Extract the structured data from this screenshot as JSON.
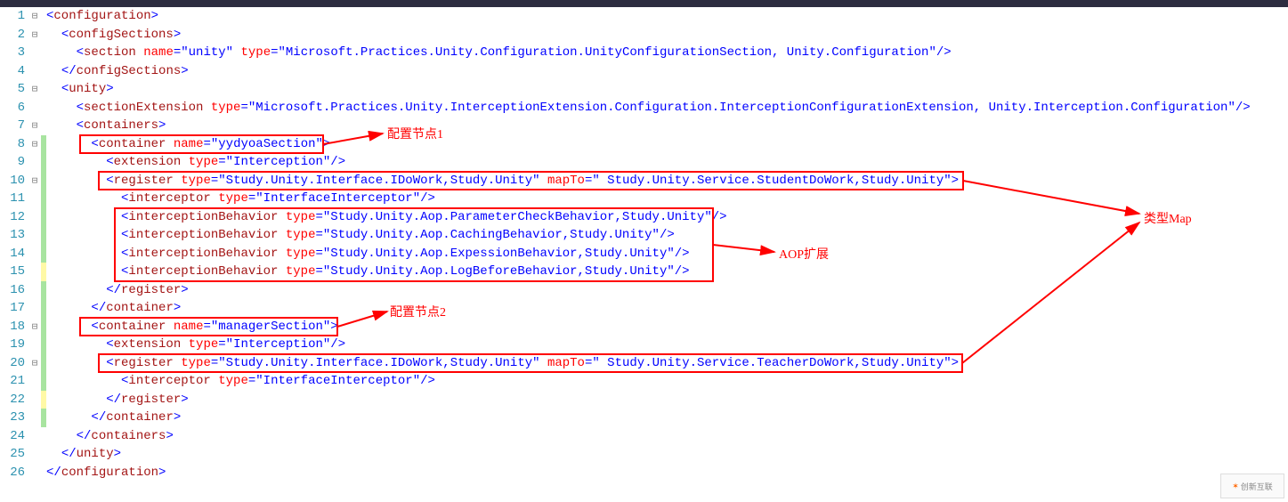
{
  "lines": [
    {
      "n": 1,
      "fold": "⊟",
      "mark": "",
      "indent": 0,
      "tokens": [
        {
          "c": "t-blue",
          "t": "<"
        },
        {
          "c": "t-maroon",
          "t": "configuration"
        },
        {
          "c": "t-blue",
          "t": ">"
        }
      ]
    },
    {
      "n": 2,
      "fold": "⊟",
      "mark": "",
      "indent": 1,
      "tokens": [
        {
          "c": "t-blue",
          "t": "<"
        },
        {
          "c": "t-maroon",
          "t": "configSections"
        },
        {
          "c": "t-blue",
          "t": ">"
        }
      ]
    },
    {
      "n": 3,
      "fold": "",
      "mark": "",
      "indent": 2,
      "tokens": [
        {
          "c": "t-blue",
          "t": "<"
        },
        {
          "c": "t-maroon",
          "t": "section"
        },
        {
          "c": "t-black",
          "t": " "
        },
        {
          "c": "t-red",
          "t": "name"
        },
        {
          "c": "t-blue",
          "t": "=\""
        },
        {
          "c": "t-blue",
          "t": "unity"
        },
        {
          "c": "t-blue",
          "t": "\" "
        },
        {
          "c": "t-red",
          "t": "type"
        },
        {
          "c": "t-blue",
          "t": "=\""
        },
        {
          "c": "t-blue",
          "t": "Microsoft.Practices.Unity.Configuration.UnityConfigurationSection, Unity.Configuration"
        },
        {
          "c": "t-blue",
          "t": "\"/>"
        }
      ]
    },
    {
      "n": 4,
      "fold": "",
      "mark": "",
      "indent": 1,
      "tokens": [
        {
          "c": "t-blue",
          "t": "</"
        },
        {
          "c": "t-maroon",
          "t": "configSections"
        },
        {
          "c": "t-blue",
          "t": ">"
        }
      ]
    },
    {
      "n": 5,
      "fold": "⊟",
      "mark": "",
      "indent": 1,
      "tokens": [
        {
          "c": "t-blue",
          "t": "<"
        },
        {
          "c": "t-maroon",
          "t": "unity"
        },
        {
          "c": "t-blue",
          "t": ">"
        }
      ]
    },
    {
      "n": 6,
      "fold": "",
      "mark": "",
      "indent": 2,
      "tokens": [
        {
          "c": "t-blue",
          "t": "<"
        },
        {
          "c": "t-maroon",
          "t": "sectionExtension"
        },
        {
          "c": "t-black",
          "t": " "
        },
        {
          "c": "t-red",
          "t": "type"
        },
        {
          "c": "t-blue",
          "t": "=\""
        },
        {
          "c": "t-blue",
          "t": "Microsoft.Practices.Unity.InterceptionExtension.Configuration.InterceptionConfigurationExtension, Unity.Interception.Configuration"
        },
        {
          "c": "t-blue",
          "t": "\"/>"
        }
      ]
    },
    {
      "n": 7,
      "fold": "⊟",
      "mark": "",
      "indent": 2,
      "tokens": [
        {
          "c": "t-blue",
          "t": "<"
        },
        {
          "c": "t-maroon",
          "t": "containers"
        },
        {
          "c": "t-blue",
          "t": ">"
        }
      ]
    },
    {
      "n": 8,
      "fold": "⊟",
      "mark": "green",
      "indent": 3,
      "tokens": [
        {
          "c": "t-blue",
          "t": "<"
        },
        {
          "c": "t-maroon",
          "t": "container"
        },
        {
          "c": "t-black",
          "t": " "
        },
        {
          "c": "t-red",
          "t": "name"
        },
        {
          "c": "t-blue",
          "t": "=\""
        },
        {
          "c": "t-blue",
          "t": "yydyoaSection"
        },
        {
          "c": "t-blue",
          "t": "\">"
        }
      ]
    },
    {
      "n": 9,
      "fold": "",
      "mark": "green",
      "indent": 4,
      "tokens": [
        {
          "c": "t-blue",
          "t": "<"
        },
        {
          "c": "t-maroon",
          "t": "extension"
        },
        {
          "c": "t-black",
          "t": " "
        },
        {
          "c": "t-red",
          "t": "type"
        },
        {
          "c": "t-blue",
          "t": "=\""
        },
        {
          "c": "t-blue",
          "t": "Interception"
        },
        {
          "c": "t-blue",
          "t": "\"/>"
        }
      ]
    },
    {
      "n": 10,
      "fold": "⊟",
      "mark": "green",
      "indent": 4,
      "tokens": [
        {
          "c": "t-blue",
          "t": "<"
        },
        {
          "c": "t-maroon",
          "t": "register"
        },
        {
          "c": "t-black",
          "t": " "
        },
        {
          "c": "t-red",
          "t": "type"
        },
        {
          "c": "t-blue",
          "t": "=\""
        },
        {
          "c": "t-blue",
          "t": "Study.Unity.Interface.IDoWork,Study.Unity"
        },
        {
          "c": "t-blue",
          "t": "\" "
        },
        {
          "c": "t-red",
          "t": "mapTo"
        },
        {
          "c": "t-blue",
          "t": "=\""
        },
        {
          "c": "t-blue",
          "t": " Study.Unity.Service.StudentDoWork,Study.Unity"
        },
        {
          "c": "t-blue",
          "t": "\">"
        }
      ]
    },
    {
      "n": 11,
      "fold": "",
      "mark": "green",
      "indent": 5,
      "tokens": [
        {
          "c": "t-blue",
          "t": "<"
        },
        {
          "c": "t-maroon",
          "t": "interceptor"
        },
        {
          "c": "t-black",
          "t": " "
        },
        {
          "c": "t-red",
          "t": "type"
        },
        {
          "c": "t-blue",
          "t": "=\""
        },
        {
          "c": "t-blue",
          "t": "InterfaceInterceptor"
        },
        {
          "c": "t-blue",
          "t": "\"/>"
        }
      ]
    },
    {
      "n": 12,
      "fold": "",
      "mark": "green",
      "indent": 5,
      "tokens": [
        {
          "c": "t-blue",
          "t": "<"
        },
        {
          "c": "t-maroon",
          "t": "interceptionBehavior"
        },
        {
          "c": "t-black",
          "t": " "
        },
        {
          "c": "t-red",
          "t": "type"
        },
        {
          "c": "t-blue",
          "t": "=\""
        },
        {
          "c": "t-blue",
          "t": "Study.Unity.Aop.ParameterCheckBehavior,Study.Unity"
        },
        {
          "c": "t-blue",
          "t": "\"/>"
        }
      ]
    },
    {
      "n": 13,
      "fold": "",
      "mark": "green",
      "indent": 5,
      "tokens": [
        {
          "c": "t-blue",
          "t": "<"
        },
        {
          "c": "t-maroon",
          "t": "interceptionBehavior"
        },
        {
          "c": "t-black",
          "t": " "
        },
        {
          "c": "t-red",
          "t": "type"
        },
        {
          "c": "t-blue",
          "t": "=\""
        },
        {
          "c": "t-blue",
          "t": "Study.Unity.Aop.CachingBehavior,Study.Unity"
        },
        {
          "c": "t-blue",
          "t": "\"/>"
        }
      ]
    },
    {
      "n": 14,
      "fold": "",
      "mark": "green",
      "indent": 5,
      "tokens": [
        {
          "c": "t-blue",
          "t": "<"
        },
        {
          "c": "t-maroon",
          "t": "interceptionBehavior"
        },
        {
          "c": "t-black",
          "t": " "
        },
        {
          "c": "t-red",
          "t": "type"
        },
        {
          "c": "t-blue",
          "t": "=\""
        },
        {
          "c": "t-blue",
          "t": "Study.Unity.Aop.ExpessionBehavior,Study.Unity"
        },
        {
          "c": "t-blue",
          "t": "\"/>"
        }
      ]
    },
    {
      "n": 15,
      "fold": "",
      "mark": "yellow",
      "indent": 5,
      "tokens": [
        {
          "c": "t-blue",
          "t": "<"
        },
        {
          "c": "t-maroon",
          "t": "interceptionBehavior"
        },
        {
          "c": "t-black",
          "t": " "
        },
        {
          "c": "t-red",
          "t": "type"
        },
        {
          "c": "t-blue",
          "t": "=\""
        },
        {
          "c": "t-blue",
          "t": "Study.Unity.Aop.LogBeforeBehavior,Study.Unity"
        },
        {
          "c": "t-blue",
          "t": "\"/>"
        }
      ]
    },
    {
      "n": 16,
      "fold": "",
      "mark": "green",
      "indent": 4,
      "tokens": [
        {
          "c": "t-blue",
          "t": "</"
        },
        {
          "c": "t-maroon",
          "t": "register"
        },
        {
          "c": "t-blue",
          "t": ">"
        }
      ]
    },
    {
      "n": 17,
      "fold": "",
      "mark": "green",
      "indent": 3,
      "tokens": [
        {
          "c": "t-blue",
          "t": "</"
        },
        {
          "c": "t-maroon",
          "t": "container"
        },
        {
          "c": "t-blue",
          "t": ">"
        }
      ]
    },
    {
      "n": 18,
      "fold": "⊟",
      "mark": "green",
      "indent": 3,
      "tokens": [
        {
          "c": "t-blue",
          "t": "<"
        },
        {
          "c": "t-maroon",
          "t": "container"
        },
        {
          "c": "t-black",
          "t": " "
        },
        {
          "c": "t-red",
          "t": "name"
        },
        {
          "c": "t-blue",
          "t": "=\""
        },
        {
          "c": "t-blue",
          "t": "managerSection"
        },
        {
          "c": "t-blue",
          "t": "\">"
        }
      ]
    },
    {
      "n": 19,
      "fold": "",
      "mark": "green",
      "indent": 4,
      "tokens": [
        {
          "c": "t-blue",
          "t": "<"
        },
        {
          "c": "t-maroon",
          "t": "extension"
        },
        {
          "c": "t-black",
          "t": " "
        },
        {
          "c": "t-red",
          "t": "type"
        },
        {
          "c": "t-blue",
          "t": "=\""
        },
        {
          "c": "t-blue",
          "t": "Interception"
        },
        {
          "c": "t-blue",
          "t": "\"/>"
        }
      ]
    },
    {
      "n": 20,
      "fold": "⊟",
      "mark": "green",
      "indent": 4,
      "tokens": [
        {
          "c": "t-blue",
          "t": "<"
        },
        {
          "c": "t-maroon",
          "t": "register"
        },
        {
          "c": "t-black",
          "t": " "
        },
        {
          "c": "t-red",
          "t": "type"
        },
        {
          "c": "t-blue",
          "t": "=\""
        },
        {
          "c": "t-blue",
          "t": "Study.Unity.Interface.IDoWork,Study.Unity"
        },
        {
          "c": "t-blue",
          "t": "\" "
        },
        {
          "c": "t-red",
          "t": "mapTo"
        },
        {
          "c": "t-blue",
          "t": "=\""
        },
        {
          "c": "t-blue",
          "t": " Study.Unity.Service.TeacherDoWork,Study.Unity"
        },
        {
          "c": "t-blue",
          "t": "\">"
        }
      ]
    },
    {
      "n": 21,
      "fold": "",
      "mark": "green",
      "indent": 5,
      "tokens": [
        {
          "c": "t-blue",
          "t": "<"
        },
        {
          "c": "t-maroon",
          "t": "interceptor"
        },
        {
          "c": "t-black",
          "t": " "
        },
        {
          "c": "t-red",
          "t": "type"
        },
        {
          "c": "t-blue",
          "t": "=\""
        },
        {
          "c": "t-blue",
          "t": "InterfaceInterceptor"
        },
        {
          "c": "t-blue",
          "t": "\"/>"
        }
      ]
    },
    {
      "n": 22,
      "fold": "",
      "mark": "yellow",
      "indent": 4,
      "tokens": [
        {
          "c": "t-blue",
          "t": "</"
        },
        {
          "c": "t-maroon",
          "t": "register"
        },
        {
          "c": "t-blue",
          "t": ">"
        }
      ]
    },
    {
      "n": 23,
      "fold": "",
      "mark": "green",
      "indent": 3,
      "tokens": [
        {
          "c": "t-blue",
          "t": "</"
        },
        {
          "c": "t-maroon",
          "t": "container"
        },
        {
          "c": "t-blue",
          "t": ">"
        }
      ]
    },
    {
      "n": 24,
      "fold": "",
      "mark": "",
      "indent": 2,
      "tokens": [
        {
          "c": "t-blue",
          "t": "</"
        },
        {
          "c": "t-maroon",
          "t": "containers"
        },
        {
          "c": "t-blue",
          "t": ">"
        }
      ]
    },
    {
      "n": 25,
      "fold": "",
      "mark": "",
      "indent": 1,
      "tokens": [
        {
          "c": "t-blue",
          "t": "</"
        },
        {
          "c": "t-maroon",
          "t": "unity"
        },
        {
          "c": "t-blue",
          "t": ">"
        }
      ]
    },
    {
      "n": 26,
      "fold": "",
      "mark": "",
      "indent": 0,
      "tokens": [
        {
          "c": "t-blue",
          "t": "</"
        },
        {
          "c": "t-maroon",
          "t": "configuration"
        },
        {
          "c": "t-blue",
          "t": ">"
        }
      ]
    }
  ],
  "annotations": {
    "label1": "配置节点1",
    "label2": "类型Map",
    "label3": "AOP扩展",
    "label4": "配置节点2"
  },
  "watermark": "创新互联"
}
